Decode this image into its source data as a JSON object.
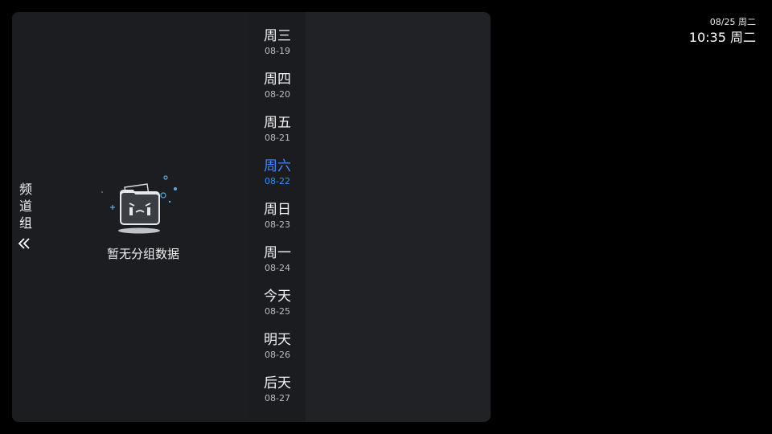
{
  "clock": {
    "date": "08/25 周二",
    "time": "10:35 周二"
  },
  "group_panel": {
    "tab_label": "频道组",
    "collapse_icon": "double-chevron-left-icon",
    "empty_illustration": "empty-folder-icon",
    "empty_text": "暂无分组数据"
  },
  "dates": {
    "selected_index": 3,
    "accent_color": "#3a8cff",
    "items": [
      {
        "day": "周三",
        "date": "08-19"
      },
      {
        "day": "周四",
        "date": "08-20"
      },
      {
        "day": "周五",
        "date": "08-21"
      },
      {
        "day": "周六",
        "date": "08-22"
      },
      {
        "day": "周日",
        "date": "08-23"
      },
      {
        "day": "周一",
        "date": "08-24"
      },
      {
        "day": "今天",
        "date": "08-25"
      },
      {
        "day": "明天",
        "date": "08-26"
      },
      {
        "day": "后天",
        "date": "08-27"
      }
    ]
  }
}
